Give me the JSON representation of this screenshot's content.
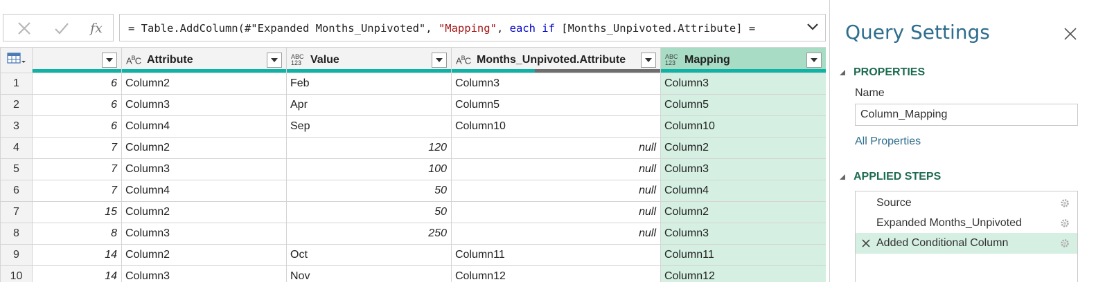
{
  "formula_bar": {
    "cancel_icon": "close-icon",
    "commit_icon": "check-icon",
    "fx_label": "fx",
    "formula_parts": {
      "p1": "= Table.AddColumn(#\"Expanded Months_Unpivoted\", ",
      "p2": "\"Mapping\"",
      "p3": ", ",
      "p4": "each if",
      "p5": " [Months_Unpivoted.Attribute] ="
    }
  },
  "grid": {
    "columns": [
      {
        "label": "",
        "type": "none"
      },
      {
        "label": "Attribute",
        "type": "ABC"
      },
      {
        "label": "Value",
        "type": "ABC123"
      },
      {
        "label": "Months_Unpivoted.Attribute",
        "type": "ABC"
      },
      {
        "label": "Mapping",
        "type": "ABC123"
      }
    ],
    "rows": [
      {
        "n": "1",
        "c0": "6",
        "c1": "Column2",
        "c2": "Feb",
        "c3": "Column3",
        "c4": "Column3"
      },
      {
        "n": "2",
        "c0": "6",
        "c1": "Column3",
        "c2": "Apr",
        "c3": "Column5",
        "c4": "Column5"
      },
      {
        "n": "3",
        "c0": "6",
        "c1": "Column4",
        "c2": "Sep",
        "c3": "Column10",
        "c4": "Column10"
      },
      {
        "n": "4",
        "c0": "7",
        "c1": "Column2",
        "c2": "120",
        "c3": "null",
        "c4": "Column2"
      },
      {
        "n": "5",
        "c0": "7",
        "c1": "Column3",
        "c2": "100",
        "c3": "null",
        "c4": "Column3"
      },
      {
        "n": "6",
        "c0": "7",
        "c1": "Column4",
        "c2": "50",
        "c3": "null",
        "c4": "Column4"
      },
      {
        "n": "7",
        "c0": "15",
        "c1": "Column2",
        "c2": "50",
        "c3": "null",
        "c4": "Column2"
      },
      {
        "n": "8",
        "c0": "8",
        "c1": "Column3",
        "c2": "250",
        "c3": "null",
        "c4": "Column3"
      },
      {
        "n": "9",
        "c0": "14",
        "c1": "Column2",
        "c2": "Oct",
        "c3": "Column11",
        "c4": "Column11"
      },
      {
        "n": "10",
        "c0": "14",
        "c1": "Column3",
        "c2": "Nov",
        "c3": "Column12",
        "c4": "Column12"
      }
    ]
  },
  "query_settings": {
    "title": "Query Settings",
    "properties_heading": "PROPERTIES",
    "name_label": "Name",
    "name_value": "Column_Mapping",
    "all_properties_link": "All Properties",
    "applied_steps_heading": "APPLIED STEPS",
    "steps": [
      {
        "label": "Source",
        "active": false
      },
      {
        "label": "Expanded Months_Unpivoted",
        "active": false
      },
      {
        "label": "Added Conditional Column",
        "active": true
      }
    ]
  },
  "colors": {
    "accent_teal": "#0fb2a4",
    "selected_header": "#a8dcc5",
    "selected_cell": "#d5efe2",
    "title_blue": "#2d6d8d",
    "heading_green": "#1d6b4f"
  }
}
